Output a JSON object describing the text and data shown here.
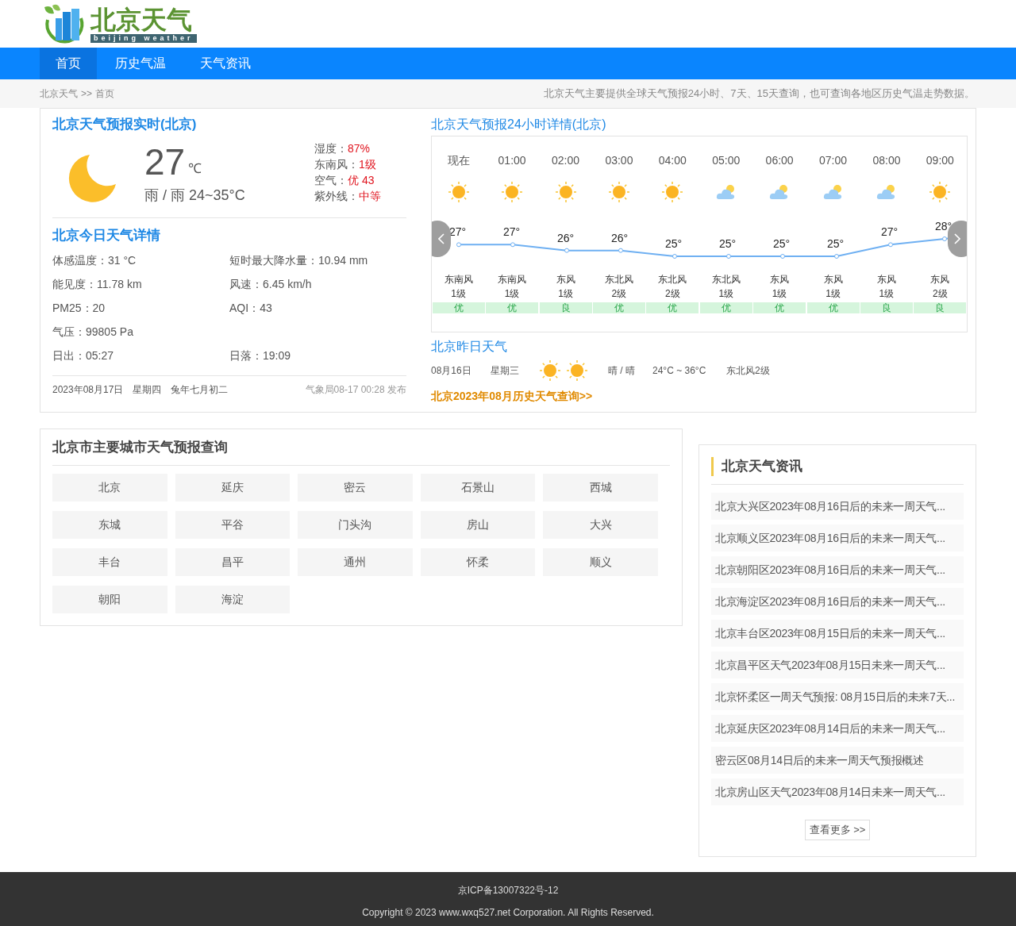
{
  "logo": {
    "title": "北京天气",
    "subtitle": "beijing weather"
  },
  "nav": [
    {
      "label": "首页",
      "selected": true
    },
    {
      "label": "历史气温",
      "selected": false
    },
    {
      "label": "天气资讯",
      "selected": false
    }
  ],
  "breadcrumb": {
    "root": "北京天气",
    "separator": ">>",
    "current": "首页"
  },
  "tagline": "北京天气主要提供全球天气预报24小时、7天、15天查询，也可查询各地区历史气温走势数据。",
  "current": {
    "title": "北京天气预报实时(北京)",
    "kind": "moon",
    "temp": "27",
    "unit": "℃",
    "summary": "雨 / 雨 24~35°C",
    "stats": [
      {
        "label": "湿度：",
        "value": "87%"
      },
      {
        "label": "东南风：",
        "value": "1级"
      },
      {
        "label": "空气：",
        "value": "优 43"
      },
      {
        "label": "紫外线：",
        "value": "中等"
      }
    ]
  },
  "today": {
    "title": "北京今日天气详情",
    "detail_rows": [
      [
        {
          "label": "体感温度：",
          "value": "31 °C"
        },
        {
          "label": "短时最大降水量：",
          "value": "10.94 mm"
        }
      ],
      [
        {
          "label": "能见度：",
          "value": "11.78 km"
        },
        {
          "label": "风速：",
          "value": "6.45 km/h"
        }
      ],
      [
        {
          "label": "PM25：",
          "value": "20"
        },
        {
          "label": "AQI：",
          "value": "43"
        }
      ],
      [
        {
          "label": "气压：",
          "value": "99805 Pa"
        }
      ],
      [
        {
          "label": "日出：",
          "value": "05:27"
        },
        {
          "label": "日落：",
          "value": "19:09"
        }
      ]
    ],
    "date": "2023年08月17日",
    "weekday": "星期四",
    "lunar": "兔年七月初二",
    "published": "气象局08-17 00:28 发布"
  },
  "hourly": {
    "title": "北京天气预报24小时详情(北京)",
    "hours": [
      {
        "time": "现在",
        "kind": "sunny",
        "temp": "27°",
        "wind": "东南风",
        "level": "1级",
        "air": "优"
      },
      {
        "time": "01:00",
        "kind": "sunny",
        "temp": "27°",
        "wind": "东南风",
        "level": "1级",
        "air": "优"
      },
      {
        "time": "02:00",
        "kind": "sunny",
        "temp": "26°",
        "wind": "东风",
        "level": "1级",
        "air": "良"
      },
      {
        "time": "03:00",
        "kind": "sunny",
        "temp": "26°",
        "wind": "东北风",
        "level": "2级",
        "air": "优"
      },
      {
        "time": "04:00",
        "kind": "sunny",
        "temp": "25°",
        "wind": "东北风",
        "level": "2级",
        "air": "优"
      },
      {
        "time": "05:00",
        "kind": "partly-cloudy",
        "temp": "25°",
        "wind": "东北风",
        "level": "1级",
        "air": "优"
      },
      {
        "time": "06:00",
        "kind": "partly-cloudy",
        "temp": "25°",
        "wind": "东风",
        "level": "1级",
        "air": "优"
      },
      {
        "time": "07:00",
        "kind": "partly-cloudy",
        "temp": "25°",
        "wind": "东风",
        "level": "1级",
        "air": "优"
      },
      {
        "time": "08:00",
        "kind": "partly-cloudy",
        "temp": "27°",
        "wind": "东风",
        "level": "1级",
        "air": "良"
      },
      {
        "time": "09:00",
        "kind": "sunny",
        "temp": "28°",
        "wind": "东风",
        "level": "2级",
        "air": "良"
      }
    ]
  },
  "yesterday": {
    "title": "北京昨日天气",
    "date": "08月16日",
    "weekday": "星期三",
    "icons": [
      {
        "kind": "sunny"
      },
      {
        "kind": "sunny"
      }
    ],
    "condition": "晴 / 晴",
    "range": "24°C ~ 36°C",
    "wind": "东北风2级",
    "history_link": "北京2023年08月历史天气查询>>"
  },
  "cities": {
    "title": "北京市主要城市天气预报查询",
    "items": [
      "北京",
      "延庆",
      "密云",
      "石景山",
      "西城",
      "东城",
      "平谷",
      "门头沟",
      "房山",
      "大兴",
      "丰台",
      "昌平",
      "通州",
      "怀柔",
      "顺义",
      "朝阳",
      "海淀"
    ]
  },
  "news": {
    "title": "北京天气资讯",
    "items": [
      "北京大兴区2023年08月16日后的未来一周天气...",
      "北京顺义区2023年08月16日后的未来一周天气...",
      "北京朝阳区2023年08月16日后的未来一周天气...",
      "北京海淀区2023年08月16日后的未来一周天气...",
      "北京丰台区2023年08月15日后的未来一周天气...",
      "北京昌平区天气2023年08月15日未来一周天气...",
      "北京怀柔区一周天气预报: 08月15日后的未来7天...",
      "北京延庆区2023年08月14日后的未来一周天气...",
      "密云区08月14日后的未来一周天气预报概述",
      "北京房山区天气2023年08月14日未来一周天气..."
    ],
    "more": "查看更多 >>"
  },
  "footer": {
    "icp": "京ICP备13007322号-12",
    "copyright": "Copyright © 2023 www.wxq527.net Corporation. All Rights Reserved."
  }
}
